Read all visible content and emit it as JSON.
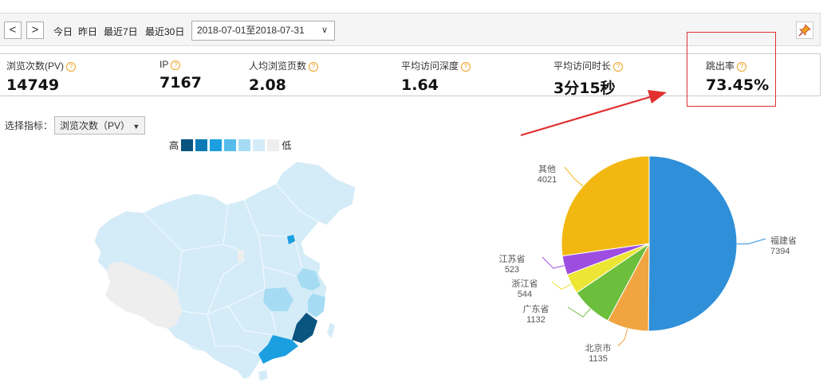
{
  "toolbar": {
    "prev_label": "<",
    "next_label": ">",
    "ranges": [
      "今日",
      "昨日",
      "最近7日",
      "最近30日"
    ],
    "date_range": "2018-07-01至2018-07-31",
    "dropdown_icon": "chevron-down-icon",
    "pin_icon": "pin-icon"
  },
  "stats": [
    {
      "label": "浏览次数(PV)",
      "value": "14749"
    },
    {
      "label": "IP",
      "value": "7167"
    },
    {
      "label": "人均浏览页数",
      "value": "2.08"
    },
    {
      "label": "平均访问深度",
      "value": "1.64"
    },
    {
      "label": "平均访问时长",
      "value": "3分15秒"
    },
    {
      "label": "跳出率",
      "value": "73.45%"
    }
  ],
  "indicator": {
    "label": "选择指标：",
    "selected": "浏览次数（PV）"
  },
  "map_legend": {
    "high": "高",
    "low": "低",
    "colors": [
      "#0a5580",
      "#0b7bb8",
      "#1c9fe0",
      "#56bdeb",
      "#a6dcf3",
      "#d4ecf8",
      "#eeeeee"
    ]
  },
  "chart_data": {
    "type": "pie",
    "slices": [
      {
        "name": "福建省",
        "value": 7394,
        "color": "#2f8fd8"
      },
      {
        "name": "北京市",
        "value": 1135,
        "color": "#f0a540"
      },
      {
        "name": "广东省",
        "value": 1132,
        "color": "#6cbf3c"
      },
      {
        "name": "浙江省",
        "value": 544,
        "color": "#ece533"
      },
      {
        "name": "江苏省",
        "value": 523,
        "color": "#9d4ee0"
      },
      {
        "name": "其他",
        "value": 4021,
        "color": "#f2b811"
      }
    ]
  },
  "map_regions": {
    "fujian": "#0a5580",
    "guangdong": "#1c9fe0",
    "zhejiang": "#a6dcf3",
    "jiangsu": "#a6dcf3",
    "beijing": "#1c9fe0",
    "tibet": "#eeeeee",
    "default": "#d4ecf8"
  },
  "annotation_color": "#e03030"
}
